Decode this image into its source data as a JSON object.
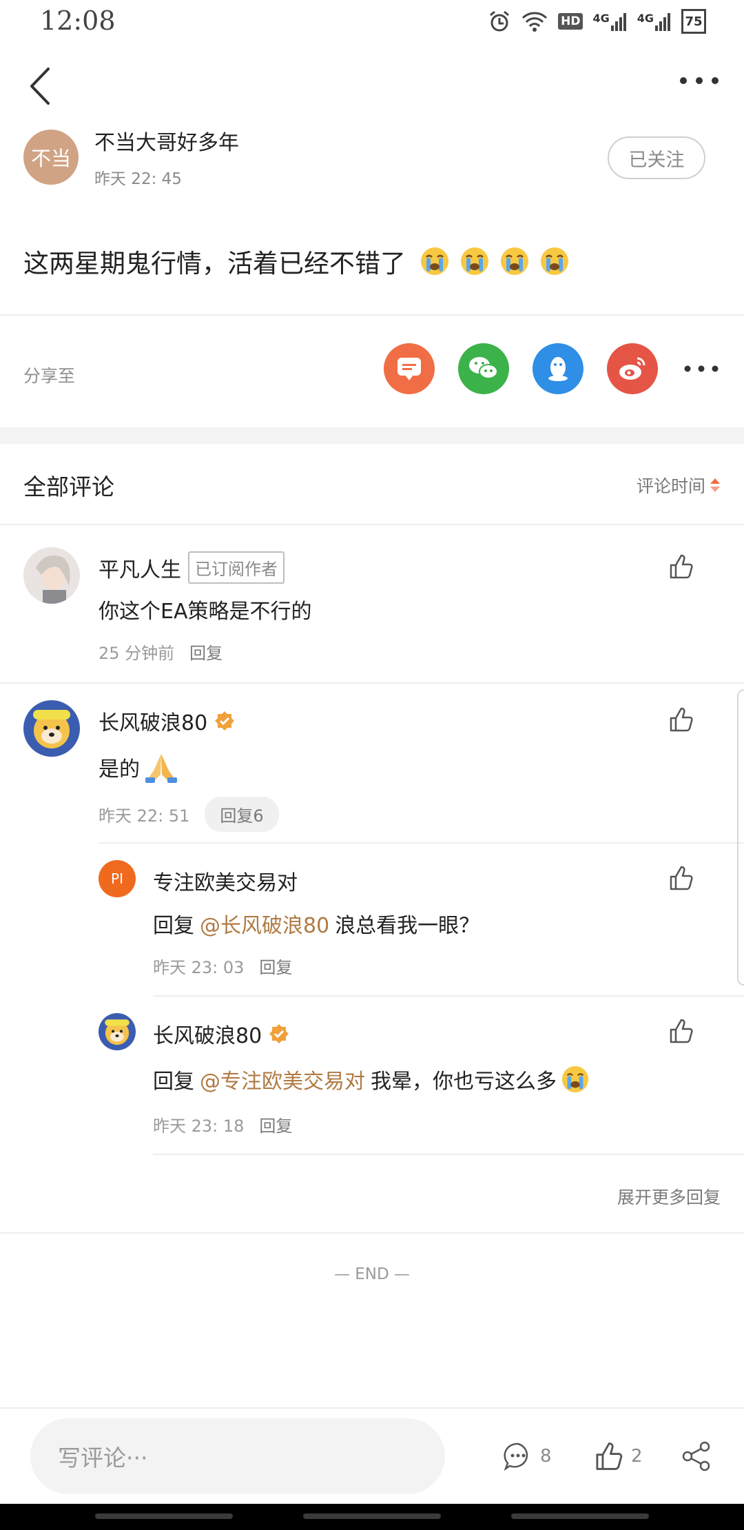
{
  "status_bar": {
    "time": "12:08",
    "hd": "HD",
    "net1": "4G",
    "net2": "4G",
    "battery": "75"
  },
  "post": {
    "author_avatar_text": "不当",
    "author_name": "不当大哥好多年",
    "time": "昨天 22: 45",
    "follow_label": "已关注",
    "text": "这两星期鬼行情，活着已经不错了",
    "emoji_count": 4
  },
  "share": {
    "label": "分享至",
    "targets": [
      "message-icon",
      "wechat-icon",
      "qq-icon",
      "weibo-icon"
    ],
    "colors": {
      "message": "#f16d45",
      "wechat": "#3cb24a",
      "qq": "#2f8ee6",
      "weibo": "#e45546"
    }
  },
  "comments_section": {
    "title": "全部评论",
    "sort_label": "评论时间"
  },
  "comments": [
    {
      "name": "平凡人生",
      "badge": "已订阅作者",
      "text": "你这个EA策略是不行的",
      "time": "25 分钟前",
      "reply_label": "回复"
    },
    {
      "name": "长风破浪80",
      "verified": true,
      "text": "是的",
      "time": "昨天 22: 51",
      "reply_label": "回复6",
      "replies": [
        {
          "avatar_text": "PI",
          "name": "专注欧美交易对",
          "prefix": "回复",
          "mention": "@长风破浪80",
          "text": "浪总看我一眼？",
          "time": "昨天 23: 03",
          "reply_label": "回复"
        },
        {
          "name": "长风破浪80",
          "verified": true,
          "prefix": "回复",
          "mention": "@专注欧美交易对",
          "text": "我晕，你也亏这么多",
          "time": "昨天 23: 18",
          "reply_label": "回复"
        }
      ]
    }
  ],
  "expand_more": "展开更多回复",
  "end_mark": "— END —",
  "bottom_bar": {
    "placeholder": "写评论···",
    "comment_count": "8",
    "like_count": "2"
  },
  "colors": {
    "accent": "#b07a43",
    "verified": "#f0a03c",
    "avatar_pi": "#f06a1e"
  }
}
